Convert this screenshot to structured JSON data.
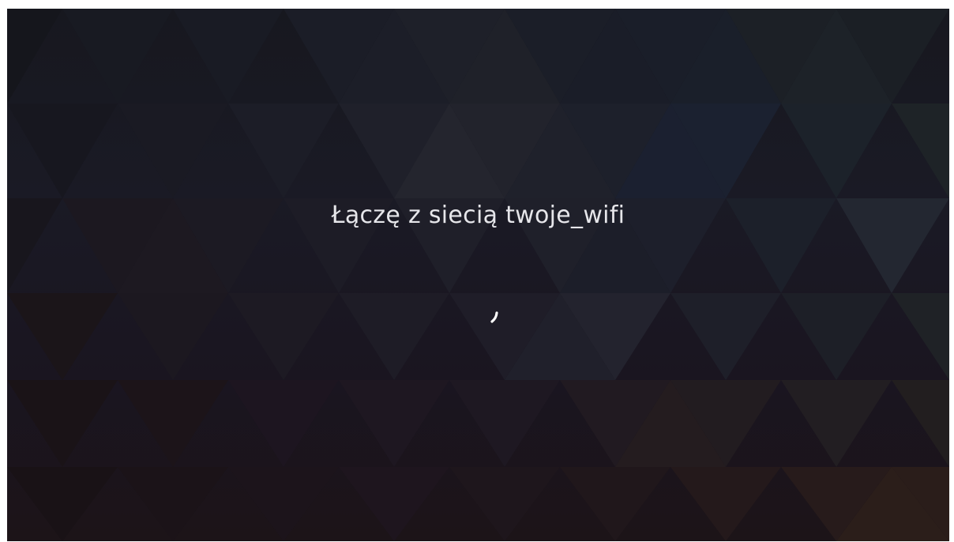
{
  "screen": {
    "status_text": "Łączę z siecią twoje_wifi",
    "spinner_icon": "loading-spinner-icon"
  },
  "colors": {
    "text": "#e6e6ea",
    "spinner": "#ffffff"
  }
}
